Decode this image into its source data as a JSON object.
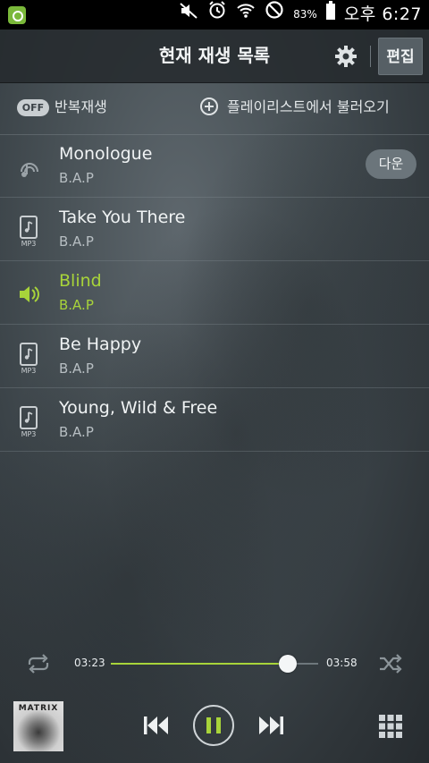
{
  "status": {
    "battery": "83%",
    "time": "오후 6:27"
  },
  "header": {
    "title": "현재 재생 목록",
    "edit_label": "편집"
  },
  "options": {
    "repeat_state": "OFF",
    "repeat_label": "반복재생",
    "load_label": "플레이리스트에서 불러오기"
  },
  "tracks": [
    {
      "title": "Monologue",
      "artist": "B.A.P",
      "badge": "다운",
      "icon": "stream-icon"
    },
    {
      "title": "Take You There",
      "artist": "B.A.P",
      "icon": "mp3-file-icon"
    },
    {
      "title": "Blind",
      "artist": "B.A.P",
      "icon": "speaker-icon",
      "playing": true
    },
    {
      "title": "Be Happy",
      "artist": "B.A.P",
      "icon": "mp3-file-icon"
    },
    {
      "title": "Young, Wild & Free",
      "artist": "B.A.P",
      "icon": "mp3-file-icon"
    }
  ],
  "player": {
    "elapsed": "03:23",
    "total": "03:58",
    "progress_fraction": 0.853,
    "album_text": "MATRIX",
    "state": "playing"
  },
  "colors": {
    "accent": "#a8d43a",
    "header_bg": "#24292d",
    "edit_button": "#565f65"
  }
}
